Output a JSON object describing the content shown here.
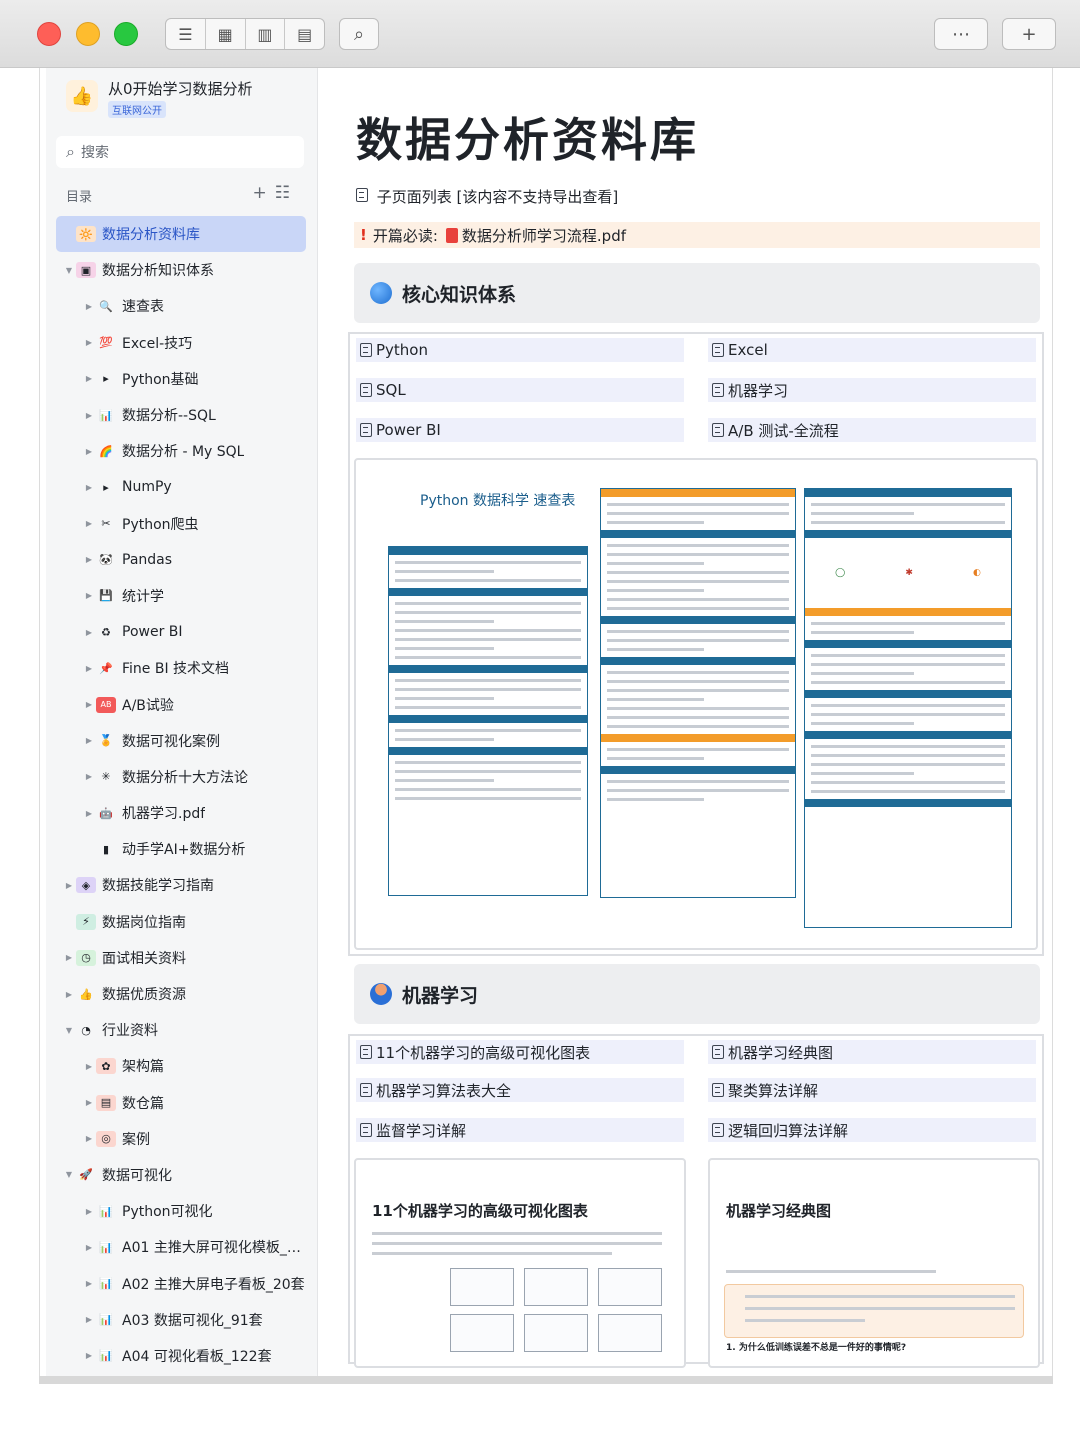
{
  "toolbar": {
    "more_label": "⋯",
    "add_label": "+"
  },
  "workspace": {
    "title": "从0开始学习数据分析",
    "badge": "互联网公开"
  },
  "search": {
    "placeholder": "搜索"
  },
  "toc": {
    "heading": "目录",
    "items": [
      {
        "label": "数据分析资料库",
        "level": 0,
        "arrow": "",
        "icon": "🔆",
        "icon_bg": "#fde3c8",
        "active": true
      },
      {
        "label": "数据分析知识体系",
        "level": 0,
        "arrow": "▼",
        "icon": "▣",
        "icon_bg": "#f6d3e8"
      },
      {
        "label": "速查表",
        "level": 1,
        "arrow": "▶",
        "icon": "🔍",
        "icon_bg": "transparent"
      },
      {
        "label": "Excel-技巧",
        "level": 1,
        "arrow": "▶",
        "icon": "💯",
        "icon_bg": "transparent"
      },
      {
        "label": "Python基础",
        "level": 1,
        "arrow": "▶",
        "icon": "▸",
        "icon_bg": "transparent"
      },
      {
        "label": "数据分析--SQL",
        "level": 1,
        "arrow": "▶",
        "icon": "📊",
        "icon_bg": "transparent"
      },
      {
        "label": "数据分析 - My SQL",
        "level": 1,
        "arrow": "▶",
        "icon": "🌈",
        "icon_bg": "transparent"
      },
      {
        "label": "NumPy",
        "level": 1,
        "arrow": "▶",
        "icon": "▸",
        "icon_bg": "transparent"
      },
      {
        "label": "Python爬虫",
        "level": 1,
        "arrow": "▶",
        "icon": "✂",
        "icon_bg": "transparent"
      },
      {
        "label": "Pandas",
        "level": 1,
        "arrow": "▶",
        "icon": "🐼",
        "icon_bg": "transparent"
      },
      {
        "label": "统计学",
        "level": 1,
        "arrow": "▶",
        "icon": "💾",
        "icon_bg": "transparent"
      },
      {
        "label": "Power BI",
        "level": 1,
        "arrow": "▶",
        "icon": "♻",
        "icon_bg": "transparent"
      },
      {
        "label": "Fine BI 技术文档",
        "level": 1,
        "arrow": "▶",
        "icon": "📌",
        "icon_bg": "transparent"
      },
      {
        "label": "A/B试验",
        "level": 1,
        "arrow": "▶",
        "icon": "AB",
        "icon_bg": "#f25a5a"
      },
      {
        "label": "数据可视化案例",
        "level": 1,
        "arrow": "▶",
        "icon": "🏅",
        "icon_bg": "transparent"
      },
      {
        "label": "数据分析十大方法论",
        "level": 1,
        "arrow": "▶",
        "icon": "✳",
        "icon_bg": "transparent"
      },
      {
        "label": "机器学习.pdf",
        "level": 1,
        "arrow": "▶",
        "icon": "🤖",
        "icon_bg": "transparent"
      },
      {
        "label": "动手学AI+数据分析",
        "level": 1,
        "arrow": "",
        "icon": "▮",
        "icon_bg": "transparent"
      },
      {
        "label": "数据技能学习指南",
        "level": 0,
        "arrow": "▶",
        "icon": "◈",
        "icon_bg": "#ddd3f7"
      },
      {
        "label": "数据岗位指南",
        "level": 0,
        "arrow": "",
        "icon": "⚡",
        "icon_bg": "#cfeee2"
      },
      {
        "label": "面试相关资料",
        "level": 0,
        "arrow": "▶",
        "icon": "◷",
        "icon_bg": "#d6f2dc"
      },
      {
        "label": "数据优质资源",
        "level": 0,
        "arrow": "▶",
        "icon": "👍",
        "icon_bg": "transparent"
      },
      {
        "label": "行业资料",
        "level": 0,
        "arrow": "▼",
        "icon": "◔",
        "icon_bg": "transparent"
      },
      {
        "label": "架构篇",
        "level": 1,
        "arrow": "▶",
        "icon": "✿",
        "icon_bg": "#fbd6cf"
      },
      {
        "label": "数仓篇",
        "level": 1,
        "arrow": "▶",
        "icon": "▤",
        "icon_bg": "#fbd6cf"
      },
      {
        "label": "案例",
        "level": 1,
        "arrow": "▶",
        "icon": "◎",
        "icon_bg": "#fbd6cf"
      },
      {
        "label": "数据可视化",
        "level": 0,
        "arrow": "▼",
        "icon": "🚀",
        "icon_bg": "transparent"
      },
      {
        "label": "Python可视化",
        "level": 1,
        "arrow": "▶",
        "icon": "📊",
        "icon_bg": "transparent"
      },
      {
        "label": "A01 主推大屏可视化模板_…",
        "level": 1,
        "arrow": "▶",
        "icon": "📊",
        "icon_bg": "transparent"
      },
      {
        "label": "A02 主推大屏电子看板_20套",
        "level": 1,
        "arrow": "▶",
        "icon": "📊",
        "icon_bg": "transparent"
      },
      {
        "label": "A03 数据可视化_91套",
        "level": 1,
        "arrow": "▶",
        "icon": "📊",
        "icon_bg": "transparent"
      },
      {
        "label": "A04 可视化看板_122套",
        "level": 1,
        "arrow": "▶",
        "icon": "📊",
        "icon_bg": "transparent"
      }
    ]
  },
  "page": {
    "title": "数据分析资料库",
    "subpages_label": "子页面列表 [该内容不支持导出查看]",
    "must_read_label": "开篇必读:",
    "must_read_file": "数据分析师学习流程.pdf"
  },
  "section1": {
    "title": "核心知识体系",
    "links": [
      "Python",
      "Excel",
      "SQL",
      "机器学习",
      "Power BI",
      "A/B 测试-全流程"
    ],
    "preview_title": "Python 数据科学 速查表"
  },
  "section2": {
    "title": "机器学习",
    "links": [
      "11个机器学习的高级可视化图表",
      "机器学习经典图",
      "机器学习算法表大全",
      "聚类算法详解",
      "监督学习详解",
      "逻辑回归算法详解"
    ],
    "preview1_title": "11个机器学习的高级可视化图表",
    "preview2_title": "机器学习经典图",
    "preview2_question": "1. 为什么低训练误差不总是一件好的事情呢?"
  }
}
